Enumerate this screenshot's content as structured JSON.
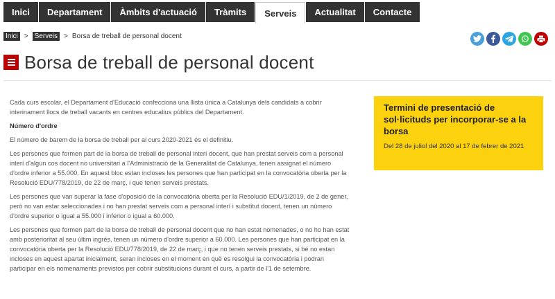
{
  "nav": {
    "items": [
      {
        "label": "Inici",
        "active": false
      },
      {
        "label": "Departament",
        "active": false
      },
      {
        "label": "Àmbits d'actuació",
        "active": false
      },
      {
        "label": "Tràmits",
        "active": false
      },
      {
        "label": "Serveis",
        "active": true
      },
      {
        "label": "Actualitat",
        "active": false
      },
      {
        "label": "Contacte",
        "active": false
      }
    ]
  },
  "breadcrumb": {
    "home": "Inici",
    "section": "Serveis",
    "separator": ">",
    "current": "Borsa de treball de personal docent"
  },
  "share": {
    "icons": [
      {
        "name": "twitter-icon",
        "color": "#4aa0d8"
      },
      {
        "name": "facebook-icon",
        "color": "#3b5998"
      },
      {
        "name": "telegram-icon",
        "color": "#2ca5e0"
      },
      {
        "name": "whatsapp-icon",
        "color": "#43c553"
      },
      {
        "name": "print-icon",
        "color": "#c00000"
      }
    ]
  },
  "page": {
    "title": "Borsa de treball de personal docent",
    "icon": "menu-icon"
  },
  "content": {
    "paragraphs": [
      "Cada curs escolar, el Departament d'Educació confecciona una llista única a Catalunya dels candidats a cobrir interinament llocs de treball vacants en centres educatius públics del Departament.",
      "Número d'ordre",
      "El número de barem de la borsa de treball per al curs 2020-2021 és el definitiu.",
      "Les persones que formen part de la borsa de treball de personal interí docent, que han prestat serveis com a personal interí d'algun cos docent no universitari a l'Administració de la Generalitat de Catalunya, tenen assignat el número d'ordre inferior a 55.000. En aquest bloc estan incloses les persones que han participat en la convocatòria oberta per la Resolució EDU/778/2019, de 22 de març, i que tenen serveis prestats.",
      "Les persones que van superar la fase d'oposició de la convocatòria oberta per la Resolució EDU/1/2019, de 2 de gener, però no van estar seleccionades i no han prestat serveis com a personal interí i substitut docent, tenen un número d'ordre superior o igual a 55.000 i inferior o igual a 60.000.",
      "Les persones que formen part de la borsa de treball de personal docent que no han estat nomenades, o no ho han estat amb posterioritat al seu últim ingrés, tenen un número d'ordre superior a 60.000. Les persones que han participat en la convocatòria oberta per la Resolució EDU/778/2019, de 22 de març, i que no tenen serveis prestats, si bé no estan incloses en aquest apartat inicialment, seran incloses en el moment en què es resolgui la convocatòria i podran participar en els nomenaments previstos per cobrir substitucions durant el curs, a partir de l'1 de setembre."
    ]
  },
  "callout": {
    "title": "Termini de presentació de sol·licituds per incorporar-se a la borsa",
    "text": "Del 28 de juliol del 2020 al 17 de febrer de 2021"
  }
}
